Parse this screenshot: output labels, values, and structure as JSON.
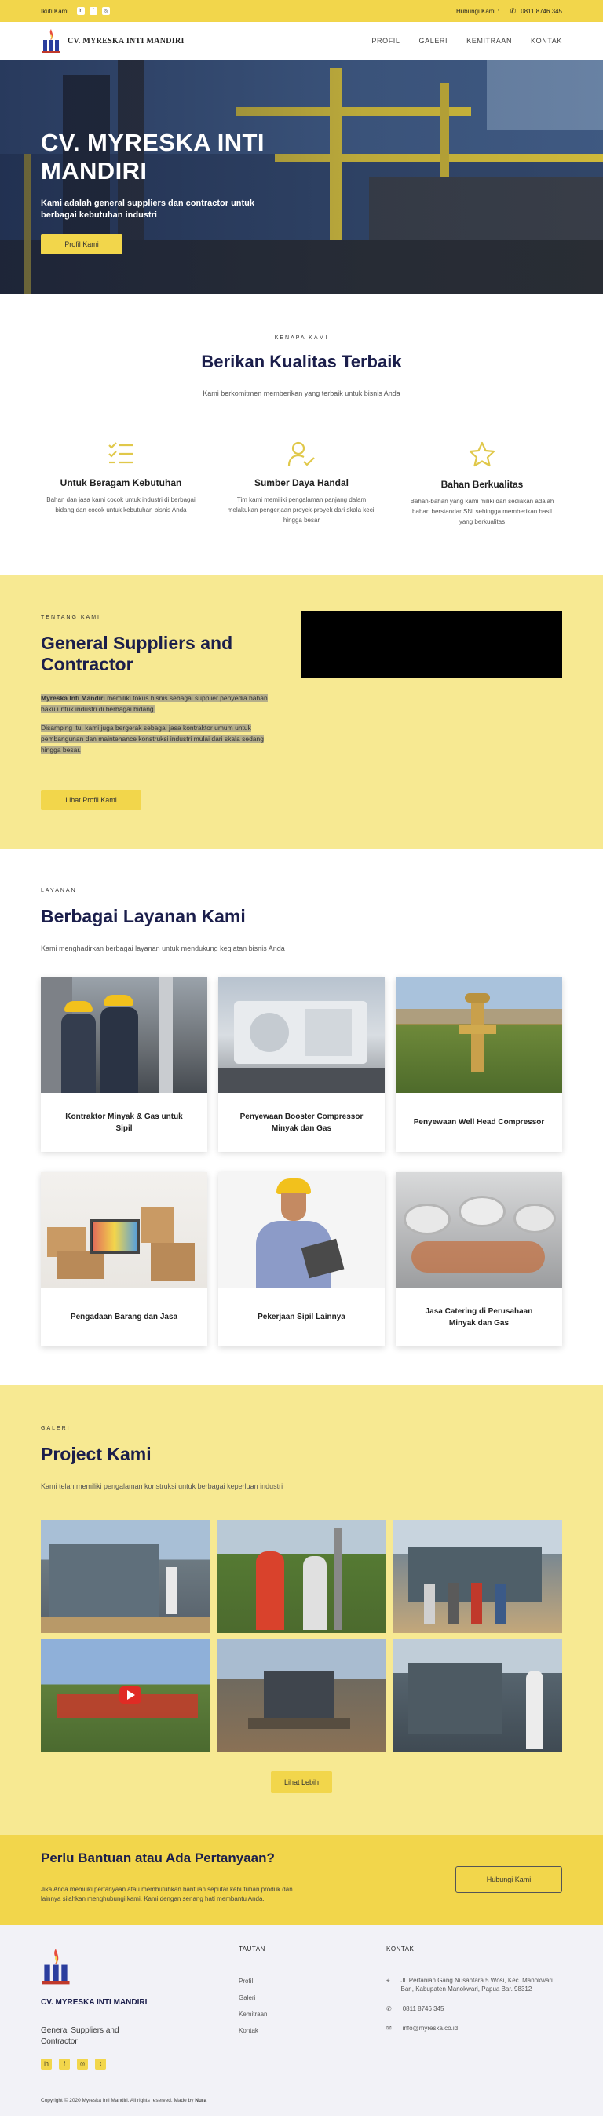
{
  "topbar": {
    "follow_label": "Ikuti Kami :",
    "contact_label": "Hubungi Kami :",
    "phone": "0811 8746 345",
    "social_icons": [
      "linkedin-icon",
      "facebook-icon",
      "instagram-icon"
    ]
  },
  "nav": {
    "brand": "CV. MYRESKA INTI MANDIRI",
    "items": [
      "PROFIL",
      "GALERI",
      "KEMITRAAN",
      "KONTAK"
    ]
  },
  "hero": {
    "title": "CV. MYRESKA INTI MANDIRI",
    "subtitle": "Kami adalah general suppliers dan contractor untuk berbagai kebutuhan industri",
    "button": "Profil Kami"
  },
  "why": {
    "eyebrow": "KENAPA KAMI",
    "title": "Berikan Kualitas Terbaik",
    "subtitle": "Kami berkomitmen memberikan yang terbaik untuk bisnis Anda",
    "features": [
      {
        "icon": "checklist-icon",
        "title": "Untuk Beragam Kebutuhan",
        "desc": "Bahan dan jasa kami cocok untuk industri di berbagai bidang dan cocok untuk kebutuhan bisnis Anda"
      },
      {
        "icon": "user-check-icon",
        "title": "Sumber Daya Handal",
        "desc": "Tim kami memiliki pengalaman panjang dalam melakukan pengerjaan proyek-proyek dari skala kecil hingga besar"
      },
      {
        "icon": "star-icon",
        "title": "Bahan Berkualitas",
        "desc": "Bahan-bahan yang kami miliki dan sediakan adalah bahan berstandar SNI sehingga memberikan hasil yang berkualitas"
      }
    ]
  },
  "about": {
    "eyebrow": "TENTANG KAMI",
    "title": "General Suppliers and Contractor",
    "company_bold": "Myreska Inti Mandiri",
    "para1_rest": " memiliki fokus bisnis sebagai supplier penyedia bahan baku untuk industri di berbagai bidang.",
    "para2": "Disamping itu, kami juga bergerak sebagai jasa kontraktor umum untuk pembangunan dan maintenance konstruksi industri mulai dari skala sedang hingga besar.",
    "button": "Lihat Profil Kami"
  },
  "services": {
    "eyebrow": "LAYANAN",
    "title": "Berbagai Layanan Kami",
    "subtitle": "Kami menghadirkan berbagai layanan untuk mendukung kegiatan bisnis Anda",
    "items": [
      "Kontraktor Minyak & Gas untuk Sipil",
      "Penyewaan Booster Compressor Minyak dan Gas",
      "Penyewaan Well Head Compressor",
      "Pengadaan Barang dan Jasa",
      "Pekerjaan Sipil Lainnya",
      "Jasa Catering di Perusahaan Minyak dan Gas"
    ]
  },
  "gallery": {
    "eyebrow": "GALERI",
    "title": "Project Kami",
    "subtitle": "Kami telah memiliki pengalaman konstruksi untuk berbagai keperluan industri",
    "button": "Lihat Lebih"
  },
  "cta": {
    "title": "Perlu Bantuan atau Ada Pertanyaan?",
    "text": "Jika Anda memiliki pertanyaan atau membutuhkan bantuan seputar kebutuhan produk dan lainnya silahkan menghubungi kami. Kami dengan senang hati membantu Anda.",
    "button": "Hubungi Kami"
  },
  "footer": {
    "company": "CV. MYRESKA INTI MANDIRI",
    "tagline": "General Suppliers and Contractor",
    "links_title": "TAUTAN",
    "links": [
      "Profil",
      "Galeri",
      "Kemitraan",
      "Kontak"
    ],
    "contact_title": "KONTAK",
    "address": "Jl. Pertanian Gang Nusantara 5 Wosi, Kec. Manokwari Bar., Kabupaten Manokwari, Papua Bar. 98312",
    "phone": "0811 8746 345",
    "email": "info@myreska.co.id",
    "social_icons": [
      "linkedin-icon",
      "facebook-icon",
      "instagram-icon",
      "twitter-icon"
    ],
    "copyright_prefix": "Copyright © 2020 Myreska Inti Mandiri. All rights reserved. Made by ",
    "made_by": "Nura"
  }
}
